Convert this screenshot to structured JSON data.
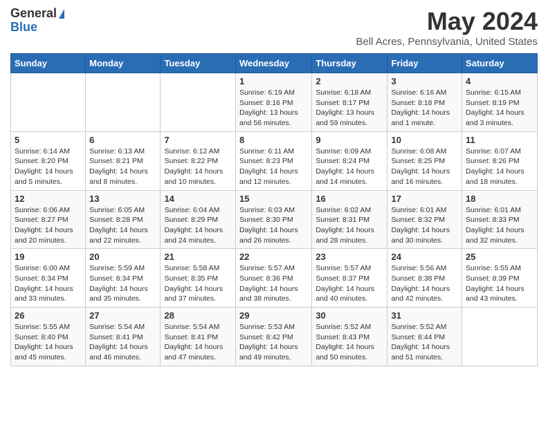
{
  "logo": {
    "general": "General",
    "blue": "Blue"
  },
  "title": "May 2024",
  "location": "Bell Acres, Pennsylvania, United States",
  "days_of_week": [
    "Sunday",
    "Monday",
    "Tuesday",
    "Wednesday",
    "Thursday",
    "Friday",
    "Saturday"
  ],
  "weeks": [
    [
      {
        "day": "",
        "info": ""
      },
      {
        "day": "",
        "info": ""
      },
      {
        "day": "",
        "info": ""
      },
      {
        "day": "1",
        "sunrise": "Sunrise: 6:19 AM",
        "sunset": "Sunset: 8:16 PM",
        "daylight": "Daylight: 13 hours and 56 minutes."
      },
      {
        "day": "2",
        "sunrise": "Sunrise: 6:18 AM",
        "sunset": "Sunset: 8:17 PM",
        "daylight": "Daylight: 13 hours and 59 minutes."
      },
      {
        "day": "3",
        "sunrise": "Sunrise: 6:16 AM",
        "sunset": "Sunset: 8:18 PM",
        "daylight": "Daylight: 14 hours and 1 minute."
      },
      {
        "day": "4",
        "sunrise": "Sunrise: 6:15 AM",
        "sunset": "Sunset: 8:19 PM",
        "daylight": "Daylight: 14 hours and 3 minutes."
      }
    ],
    [
      {
        "day": "5",
        "sunrise": "Sunrise: 6:14 AM",
        "sunset": "Sunset: 8:20 PM",
        "daylight": "Daylight: 14 hours and 5 minutes."
      },
      {
        "day": "6",
        "sunrise": "Sunrise: 6:13 AM",
        "sunset": "Sunset: 8:21 PM",
        "daylight": "Daylight: 14 hours and 8 minutes."
      },
      {
        "day": "7",
        "sunrise": "Sunrise: 6:12 AM",
        "sunset": "Sunset: 8:22 PM",
        "daylight": "Daylight: 14 hours and 10 minutes."
      },
      {
        "day": "8",
        "sunrise": "Sunrise: 6:11 AM",
        "sunset": "Sunset: 8:23 PM",
        "daylight": "Daylight: 14 hours and 12 minutes."
      },
      {
        "day": "9",
        "sunrise": "Sunrise: 6:09 AM",
        "sunset": "Sunset: 8:24 PM",
        "daylight": "Daylight: 14 hours and 14 minutes."
      },
      {
        "day": "10",
        "sunrise": "Sunrise: 6:08 AM",
        "sunset": "Sunset: 8:25 PM",
        "daylight": "Daylight: 14 hours and 16 minutes."
      },
      {
        "day": "11",
        "sunrise": "Sunrise: 6:07 AM",
        "sunset": "Sunset: 8:26 PM",
        "daylight": "Daylight: 14 hours and 18 minutes."
      }
    ],
    [
      {
        "day": "12",
        "sunrise": "Sunrise: 6:06 AM",
        "sunset": "Sunset: 8:27 PM",
        "daylight": "Daylight: 14 hours and 20 minutes."
      },
      {
        "day": "13",
        "sunrise": "Sunrise: 6:05 AM",
        "sunset": "Sunset: 8:28 PM",
        "daylight": "Daylight: 14 hours and 22 minutes."
      },
      {
        "day": "14",
        "sunrise": "Sunrise: 6:04 AM",
        "sunset": "Sunset: 8:29 PM",
        "daylight": "Daylight: 14 hours and 24 minutes."
      },
      {
        "day": "15",
        "sunrise": "Sunrise: 6:03 AM",
        "sunset": "Sunset: 8:30 PM",
        "daylight": "Daylight: 14 hours and 26 minutes."
      },
      {
        "day": "16",
        "sunrise": "Sunrise: 6:02 AM",
        "sunset": "Sunset: 8:31 PM",
        "daylight": "Daylight: 14 hours and 28 minutes."
      },
      {
        "day": "17",
        "sunrise": "Sunrise: 6:01 AM",
        "sunset": "Sunset: 8:32 PM",
        "daylight": "Daylight: 14 hours and 30 minutes."
      },
      {
        "day": "18",
        "sunrise": "Sunrise: 6:01 AM",
        "sunset": "Sunset: 8:33 PM",
        "daylight": "Daylight: 14 hours and 32 minutes."
      }
    ],
    [
      {
        "day": "19",
        "sunrise": "Sunrise: 6:00 AM",
        "sunset": "Sunset: 8:34 PM",
        "daylight": "Daylight: 14 hours and 33 minutes."
      },
      {
        "day": "20",
        "sunrise": "Sunrise: 5:59 AM",
        "sunset": "Sunset: 8:34 PM",
        "daylight": "Daylight: 14 hours and 35 minutes."
      },
      {
        "day": "21",
        "sunrise": "Sunrise: 5:58 AM",
        "sunset": "Sunset: 8:35 PM",
        "daylight": "Daylight: 14 hours and 37 minutes."
      },
      {
        "day": "22",
        "sunrise": "Sunrise: 5:57 AM",
        "sunset": "Sunset: 8:36 PM",
        "daylight": "Daylight: 14 hours and 38 minutes."
      },
      {
        "day": "23",
        "sunrise": "Sunrise: 5:57 AM",
        "sunset": "Sunset: 8:37 PM",
        "daylight": "Daylight: 14 hours and 40 minutes."
      },
      {
        "day": "24",
        "sunrise": "Sunrise: 5:56 AM",
        "sunset": "Sunset: 8:38 PM",
        "daylight": "Daylight: 14 hours and 42 minutes."
      },
      {
        "day": "25",
        "sunrise": "Sunrise: 5:55 AM",
        "sunset": "Sunset: 8:39 PM",
        "daylight": "Daylight: 14 hours and 43 minutes."
      }
    ],
    [
      {
        "day": "26",
        "sunrise": "Sunrise: 5:55 AM",
        "sunset": "Sunset: 8:40 PM",
        "daylight": "Daylight: 14 hours and 45 minutes."
      },
      {
        "day": "27",
        "sunrise": "Sunrise: 5:54 AM",
        "sunset": "Sunset: 8:41 PM",
        "daylight": "Daylight: 14 hours and 46 minutes."
      },
      {
        "day": "28",
        "sunrise": "Sunrise: 5:54 AM",
        "sunset": "Sunset: 8:41 PM",
        "daylight": "Daylight: 14 hours and 47 minutes."
      },
      {
        "day": "29",
        "sunrise": "Sunrise: 5:53 AM",
        "sunset": "Sunset: 8:42 PM",
        "daylight": "Daylight: 14 hours and 49 minutes."
      },
      {
        "day": "30",
        "sunrise": "Sunrise: 5:52 AM",
        "sunset": "Sunset: 8:43 PM",
        "daylight": "Daylight: 14 hours and 50 minutes."
      },
      {
        "day": "31",
        "sunrise": "Sunrise: 5:52 AM",
        "sunset": "Sunset: 8:44 PM",
        "daylight": "Daylight: 14 hours and 51 minutes."
      },
      {
        "day": "",
        "info": ""
      }
    ]
  ]
}
